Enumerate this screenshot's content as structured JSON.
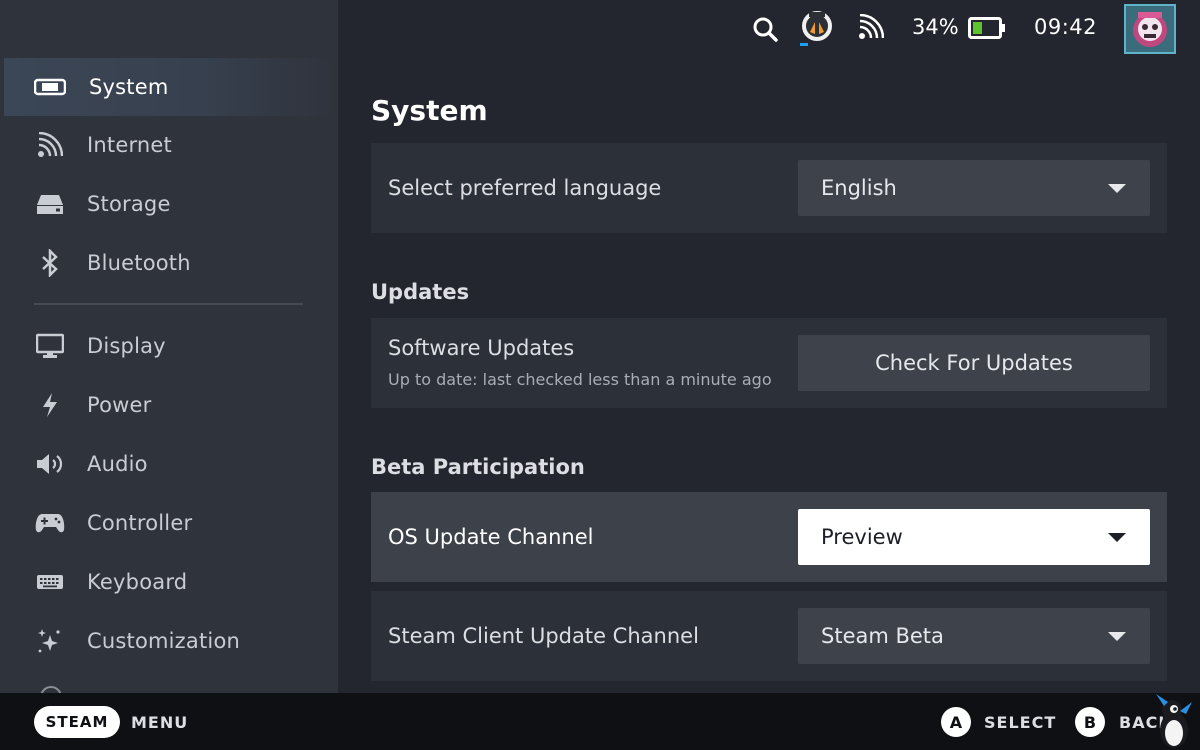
{
  "status": {
    "battery": "34%",
    "time": "09:42"
  },
  "sidebar": {
    "items": [
      {
        "label": "System",
        "icon": "system-icon",
        "active": true
      },
      {
        "label": "Internet",
        "icon": "wifi-icon"
      },
      {
        "label": "Storage",
        "icon": "storage-icon"
      },
      {
        "label": "Bluetooth",
        "icon": "bluetooth-icon"
      },
      {
        "label": "Display",
        "icon": "display-icon"
      },
      {
        "label": "Power",
        "icon": "power-bolt-icon"
      },
      {
        "label": "Audio",
        "icon": "speaker-icon"
      },
      {
        "label": "Controller",
        "icon": "gamepad-icon"
      },
      {
        "label": "Keyboard",
        "icon": "keyboard-icon"
      },
      {
        "label": "Customization",
        "icon": "sparkle-icon"
      }
    ]
  },
  "main": {
    "title": "System",
    "language": {
      "label": "Select preferred language",
      "value": "English"
    },
    "updates": {
      "heading": "Updates",
      "label": "Software Updates",
      "sub": "Up to date: last checked less than a minute ago",
      "button": "Check For Updates"
    },
    "beta": {
      "heading": "Beta Participation",
      "os_label": "OS Update Channel",
      "os_value": "Preview",
      "client_label": "Steam Client Update Channel",
      "client_value": "Steam Beta"
    }
  },
  "bottombar": {
    "steam": "STEAM",
    "menu": "MENU",
    "a_key": "A",
    "select": "SELECT",
    "b_key": "B",
    "back": "BACK"
  },
  "colors": {
    "sidebar_bg": "#2f333c",
    "main_bg": "#23262e",
    "row_bg": "#2c3039",
    "highlight_bg": "#3d4149",
    "accent": "#1a9fff",
    "battery_green": "#5ec22c"
  }
}
